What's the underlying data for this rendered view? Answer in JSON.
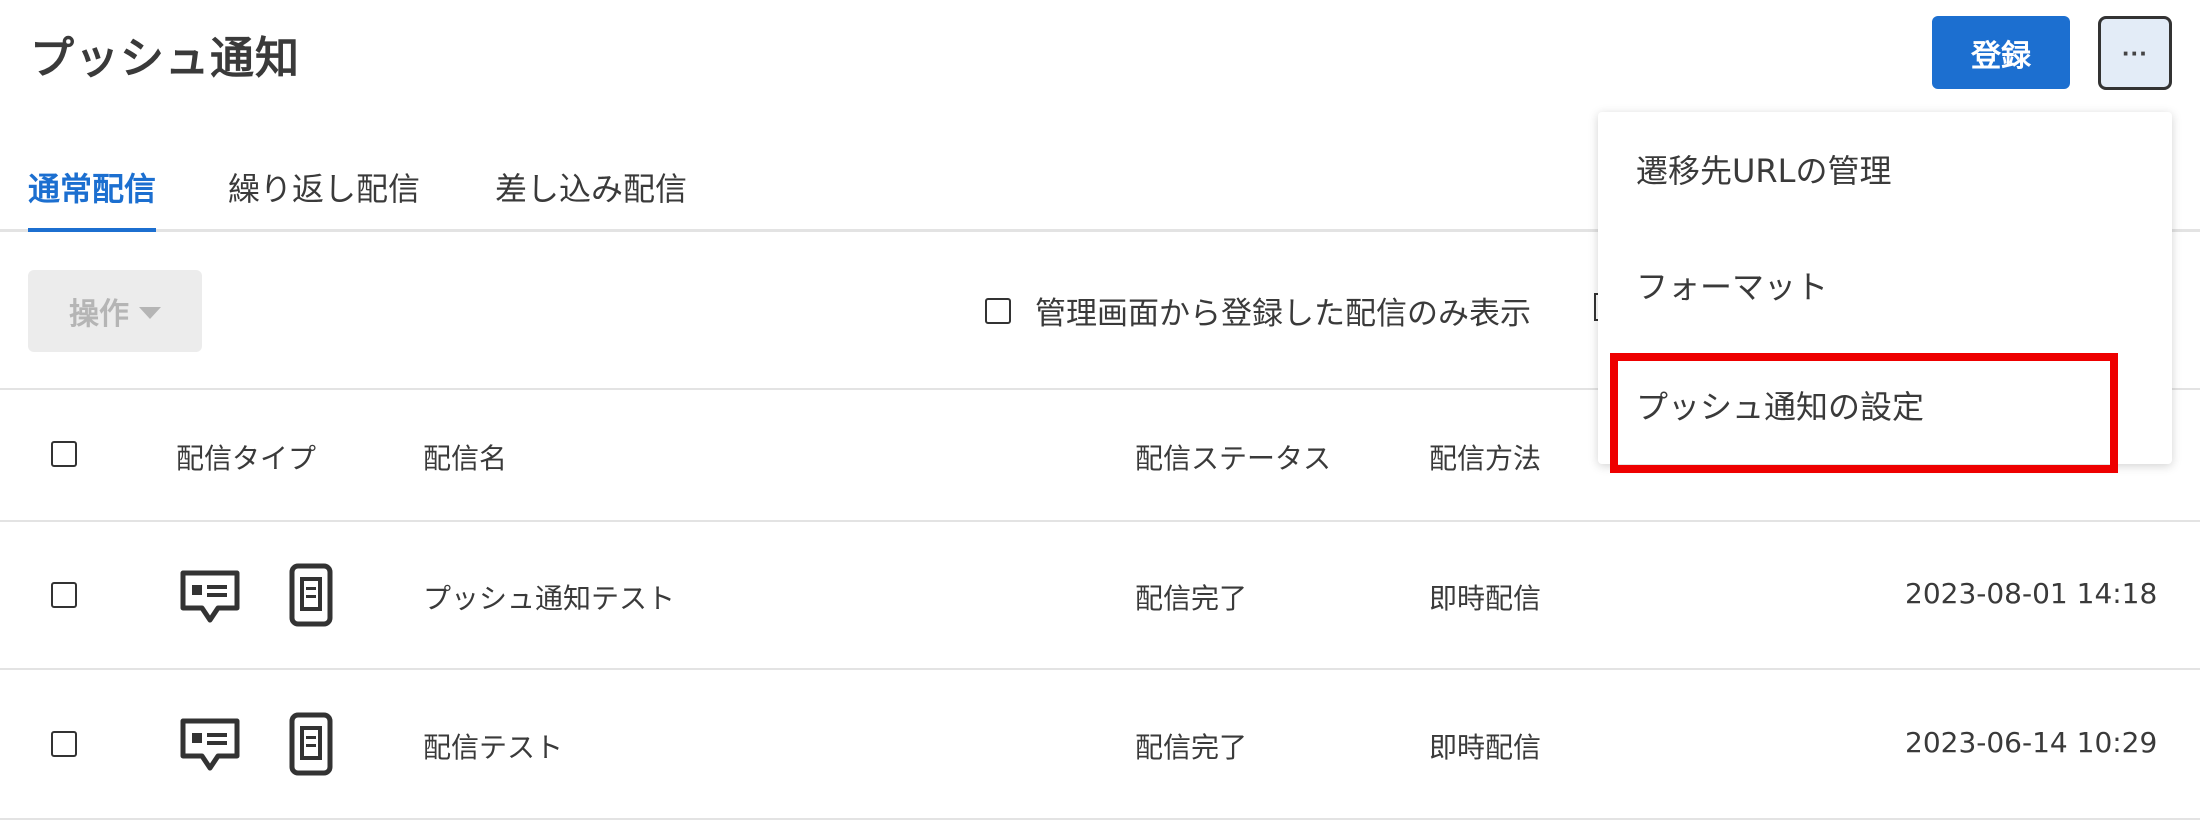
{
  "header": {
    "title": "プッシュ通知",
    "register_label": "登録",
    "more_label": "···"
  },
  "tabs": [
    {
      "label": "通常配信",
      "active": true
    },
    {
      "label": "繰り返し配信",
      "active": false
    },
    {
      "label": "差し込み配信",
      "active": false
    }
  ],
  "toolbar": {
    "ops_label": "操作",
    "filter_label": "管理画面から登録した配信のみ表示"
  },
  "table": {
    "headers": [
      "配信タイプ",
      "配信名",
      "配信ステータス",
      "配信方法"
    ],
    "rows": [
      {
        "name": "プッシュ通知テスト",
        "status": "配信完了",
        "method": "即時配信",
        "datetime": "2023-08-01 14:18"
      },
      {
        "name": "配信テスト",
        "status": "配信完了",
        "method": "即時配信",
        "datetime": "2023-06-14 10:29"
      }
    ]
  },
  "menu": {
    "items": [
      "遷移先URLの管理",
      "フォーマット",
      "プッシュ通知の設定"
    ]
  },
  "colors": {
    "accent": "#1c6fd0",
    "highlight": "#ee0000"
  }
}
